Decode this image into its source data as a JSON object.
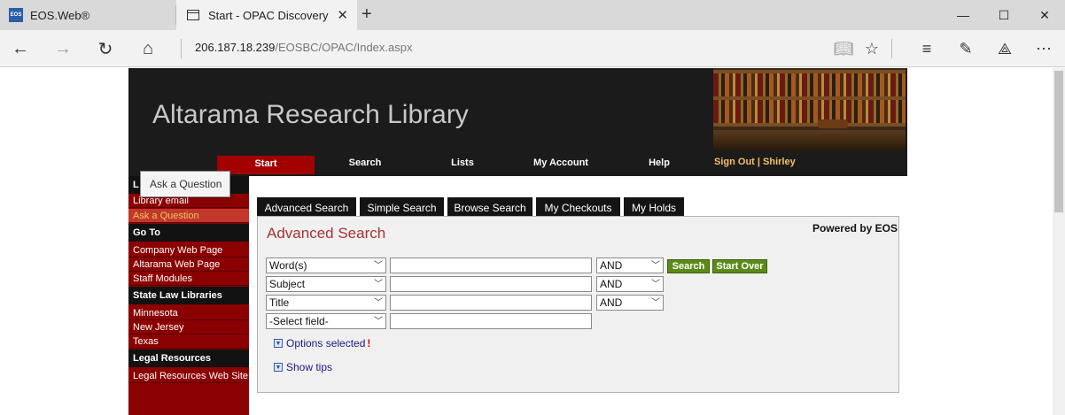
{
  "browser": {
    "tabs": [
      {
        "label": "EOS.Web®",
        "favicon": "EOS",
        "active": false
      },
      {
        "label": "Start - OPAC Discovery",
        "active": true
      }
    ],
    "url_host": "206.187.18.239",
    "url_path": "/EOSBC/OPAC/Index.aspx"
  },
  "banner": {
    "title": "Altarama Research Library"
  },
  "nav": {
    "items": [
      "Start",
      "Search",
      "Lists",
      "My Account",
      "Help"
    ],
    "active": "Start",
    "signout": "Sign Out | Shirley"
  },
  "sidebar": {
    "first_head_partial": "L",
    "links_top": [
      "Library email",
      "Ask a Question"
    ],
    "goto_head": "Go To",
    "goto_links": [
      "Company Web Page",
      "Altarama Web Page",
      "Staff Modules"
    ],
    "state_head": "State Law Libraries",
    "state_links": [
      "Minnesota",
      "New Jersey",
      "Texas"
    ],
    "legal_head": "Legal Resources",
    "legal_links": [
      "Legal Resources Web Site"
    ]
  },
  "tooltip": "Ask a Question",
  "search_tabs": [
    "Advanced Search",
    "Simple Search",
    "Browse Search",
    "My Checkouts",
    "My Holds"
  ],
  "panel": {
    "title": "Advanced Search",
    "powered_by": "Powered by EOS",
    "rows": [
      {
        "field": "Word(s)",
        "value": "",
        "bool": "AND"
      },
      {
        "field": "Subject",
        "value": "",
        "bool": "AND"
      },
      {
        "field": "Title",
        "value": "",
        "bool": "AND"
      },
      {
        "field": "-Select field-",
        "value": ""
      }
    ],
    "search_button": "Search",
    "start_over_button": "Start Over",
    "options_label": "Options selected",
    "options_flag": "!",
    "tips_label": "Show tips"
  },
  "colors": {
    "banner_bg": "#1b1b1b",
    "active_nav": "#a30000",
    "sidebar_bg": "#8b0000",
    "panel_title": "#a83232",
    "button_green": "#5b8a18",
    "signout": "#f5c060"
  }
}
